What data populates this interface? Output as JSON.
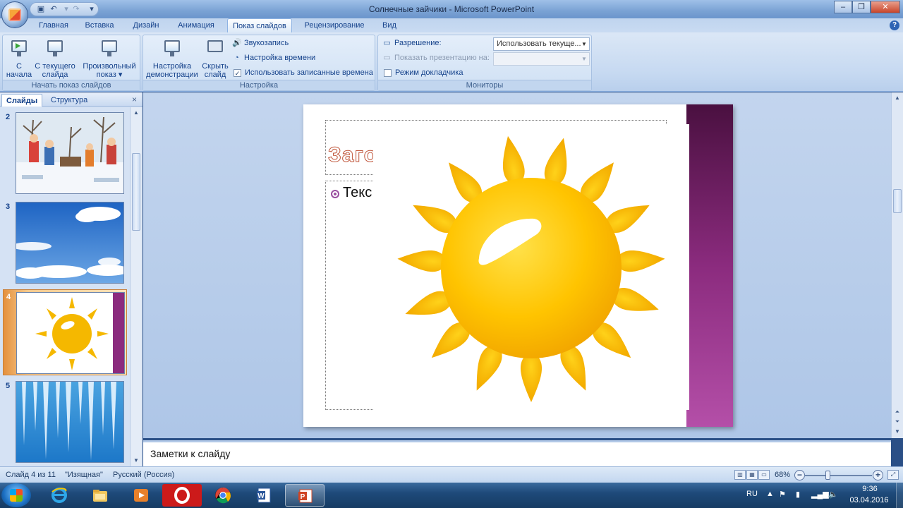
{
  "window": {
    "title": "Солнечные зайчики - Microsoft PowerPoint",
    "minimize": "–",
    "maximize": "❐",
    "close": "✕"
  },
  "tabs": [
    {
      "label": "Главная"
    },
    {
      "label": "Вставка"
    },
    {
      "label": "Дизайн"
    },
    {
      "label": "Анимация"
    },
    {
      "label": "Показ слайдов",
      "active": true
    },
    {
      "label": "Рецензирование"
    },
    {
      "label": "Вид"
    }
  ],
  "ribbon": {
    "start_group": {
      "label": "Начать показ слайдов",
      "from_start": "С начала",
      "from_current": "С текущего слайда",
      "custom_show": "Произвольный показ ▾"
    },
    "setup_group": {
      "label": "Настройка",
      "setup_show": "Настройка демонстрации",
      "hide_slide": "Скрыть слайд",
      "record_narration": "Звукозапись",
      "rehearse_timings": "Настройка времени",
      "use_timings": "Использовать записанные времена",
      "use_timings_checked": true
    },
    "monitors_group": {
      "label": "Мониторы",
      "resolution_label": "Разрешение:",
      "resolution_value": "Использовать текуще...",
      "show_on_label": "Показать презентацию на:",
      "show_on_value": "",
      "presenter_view": "Режим докладчика",
      "presenter_view_checked": false
    }
  },
  "left_panel": {
    "tab_slides": "Слайды",
    "tab_outline": "Структура",
    "close": "×",
    "slides": [
      {
        "number": "2",
        "icon": "winter-kids-thumbnail"
      },
      {
        "number": "3",
        "icon": "sky-clouds-thumbnail"
      },
      {
        "number": "4",
        "icon": "sun-thumbnail",
        "selected": true
      },
      {
        "number": "5",
        "icon": "icicles-thumbnail"
      }
    ]
  },
  "slide": {
    "title_placeholder": "Загол",
    "body_placeholder": "Текс",
    "image": "sun-image"
  },
  "notes": {
    "placeholder": "Заметки к слайду"
  },
  "status": {
    "slide_info": "Слайд 4 из 11",
    "theme": "\"Изящная\"",
    "language": "Русский (Россия)",
    "zoom": "68%"
  },
  "taskbar": {
    "apps": [
      {
        "name": "internet-explorer"
      },
      {
        "name": "file-explorer"
      },
      {
        "name": "media-player"
      },
      {
        "name": "opera"
      },
      {
        "name": "chrome"
      },
      {
        "name": "word"
      },
      {
        "name": "powerpoint",
        "active": true
      }
    ],
    "language": "RU",
    "time": "9:36",
    "date": "03.04.2016"
  },
  "colors": {
    "ribbon_text": "#15428b",
    "slide_stripe": "#8b2b7e",
    "sun": "#f5b800"
  }
}
